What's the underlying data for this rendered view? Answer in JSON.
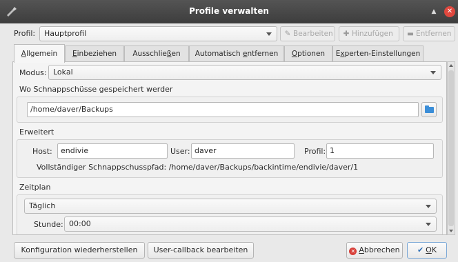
{
  "window": {
    "title": "Profile verwalten",
    "app_icon": "tools-icon",
    "up_icon": "▲",
    "close_icon": "✕"
  },
  "profile": {
    "label": "Profil:",
    "value": "Hauptprofil",
    "edit_label": "Bearbeiten",
    "add_label": "Hinzufügen",
    "remove_label": "Entfernen"
  },
  "tabs": [
    {
      "pre": "",
      "ul": "A",
      "post": "llgemein"
    },
    {
      "pre": "",
      "ul": "E",
      "post": "inbeziehen"
    },
    {
      "pre": "Ausschlie",
      "ul": "ß",
      "post": "en"
    },
    {
      "pre": "Automatisch ",
      "ul": "e",
      "post": "ntfernen"
    },
    {
      "pre": "",
      "ul": "O",
      "post": "ptionen"
    },
    {
      "pre": "E",
      "ul": "x",
      "post": "perten-Einstellungen"
    }
  ],
  "general": {
    "mode_label": "Modus:",
    "mode_value": "Lokal",
    "where_label": "Wo Schnappschüsse gespeichert werder",
    "path_value": "/home/daver/Backups"
  },
  "advanced": {
    "heading": "Erweitert",
    "host_label": "Host:",
    "host_value": "endivie",
    "user_label": "User:",
    "user_value": "daver",
    "profile_label": "Profil:",
    "profile_value": "1",
    "full_path_text": "Vollständiger Schnappschusspfad: /home/daver/Backups/backintime/endivie/daver/1"
  },
  "schedule": {
    "heading": "Zeitplan",
    "frequency_value": "Täglich",
    "hour_label": "Stunde:",
    "hour_value": "00:00"
  },
  "footer": {
    "restore_config_label": "Konfiguration wiederherstellen",
    "user_callback_label": "User-callback bearbeiten",
    "cancel_pre": "",
    "cancel_ul": "A",
    "cancel_post": "bbrechen",
    "ok_pre": "",
    "ok_ul": "O",
    "ok_post": "K"
  }
}
